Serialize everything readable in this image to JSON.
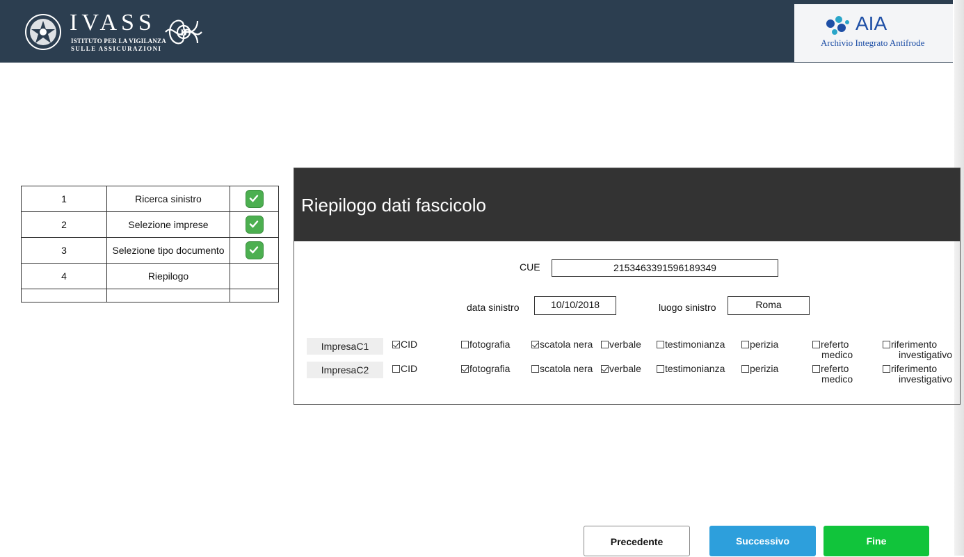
{
  "header": {
    "ivass_title": "IVASS",
    "ivass_sub1": "ISTITUTO PER LA VIGILANZA",
    "ivass_sub2": "SULLE ASSICURAZIONI",
    "aia_title": "AIA",
    "aia_subtitle": "Archivio Integrato Antifrode",
    "colors": {
      "bar": "#2c3e50",
      "aia": "#1e4fa6"
    }
  },
  "steps": [
    {
      "num": "1",
      "label": "Ricerca sinistro",
      "done": true
    },
    {
      "num": "2",
      "label": "Selezione imprese",
      "done": true
    },
    {
      "num": "3",
      "label": "Selezione tipo documento",
      "done": true
    },
    {
      "num": "4",
      "label": "Riepilogo",
      "done": false
    }
  ],
  "summary": {
    "title": "Riepilogo dati fascicolo",
    "cue_label": "CUE",
    "cue_value": "2153463391596189349",
    "date_label": "data sinistro",
    "date_value": "10/10/2018",
    "place_label": "luogo sinistro",
    "place_value": "Roma",
    "companies": [
      {
        "name": "ImpresaC1",
        "docs": [
          {
            "label": "CID",
            "checked": true
          },
          {
            "label": "fotografia",
            "checked": false
          },
          {
            "label": "scatola nera",
            "checked": true
          },
          {
            "label": "verbale",
            "checked": false
          },
          {
            "label": "testimonianza",
            "checked": false
          },
          {
            "label": "perizia",
            "checked": false
          },
          {
            "label": "referto medico",
            "label1": "referto",
            "label2": "medico",
            "checked": false
          },
          {
            "label": "riferimento investigativo",
            "label1": "riferimento",
            "label2": "investigativo",
            "checked": false
          }
        ]
      },
      {
        "name": "ImpresaC2",
        "docs": [
          {
            "label": "CID",
            "checked": false
          },
          {
            "label": "fotografia",
            "checked": true
          },
          {
            "label": "scatola nera",
            "checked": false
          },
          {
            "label": "verbale",
            "checked": true
          },
          {
            "label": "testimonianza",
            "checked": false
          },
          {
            "label": "perizia",
            "checked": false
          },
          {
            "label": "referto medico",
            "label1": "referto",
            "label2": "medico",
            "checked": false
          },
          {
            "label": "riferimento investigativo",
            "label1": "riferimento",
            "label2": "investigativo",
            "checked": false
          }
        ]
      }
    ]
  },
  "buttons": {
    "prev": "Precedente",
    "next": "Successivo",
    "end": "Fine",
    "colors": {
      "next": "#2d9fdc",
      "end": "#11c43b"
    }
  }
}
